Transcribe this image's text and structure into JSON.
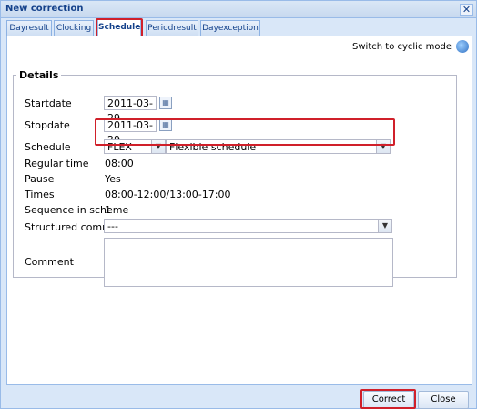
{
  "window": {
    "title": "New correction"
  },
  "tabs": [
    {
      "label": "Dayresult"
    },
    {
      "label": "Clocking"
    },
    {
      "label": "Schedule"
    },
    {
      "label": "Periodresult"
    },
    {
      "label": "Dayexception"
    }
  ],
  "active_tab": "Schedule",
  "cyclic_mode": {
    "label": "Switch to cyclic mode",
    "icon": "refresh-icon"
  },
  "details": {
    "legend": "Details",
    "startdate": {
      "label": "Startdate",
      "value": "2011-03-29"
    },
    "stopdate": {
      "label": "Stopdate",
      "value": "2011-03-29"
    },
    "schedule": {
      "label": "Schedule",
      "code": "FLEX",
      "name": "Flexible schedule"
    },
    "regular_time": {
      "label": "Regular time",
      "value": "08:00"
    },
    "pause": {
      "label": "Pause",
      "value": "Yes"
    },
    "times": {
      "label": "Times",
      "value": "08:00-12:00/13:00-17:00"
    },
    "sequence": {
      "label": "Sequence in scheme",
      "value": "1"
    },
    "structured_comment": {
      "label": "Structured comment",
      "value": "---"
    },
    "comment": {
      "label": "Comment",
      "value": ""
    }
  },
  "buttons": {
    "correct": "Correct",
    "close": "Close"
  },
  "colors": {
    "highlight": "#d0202a",
    "accent": "#15428b",
    "border": "#99bbe8"
  }
}
